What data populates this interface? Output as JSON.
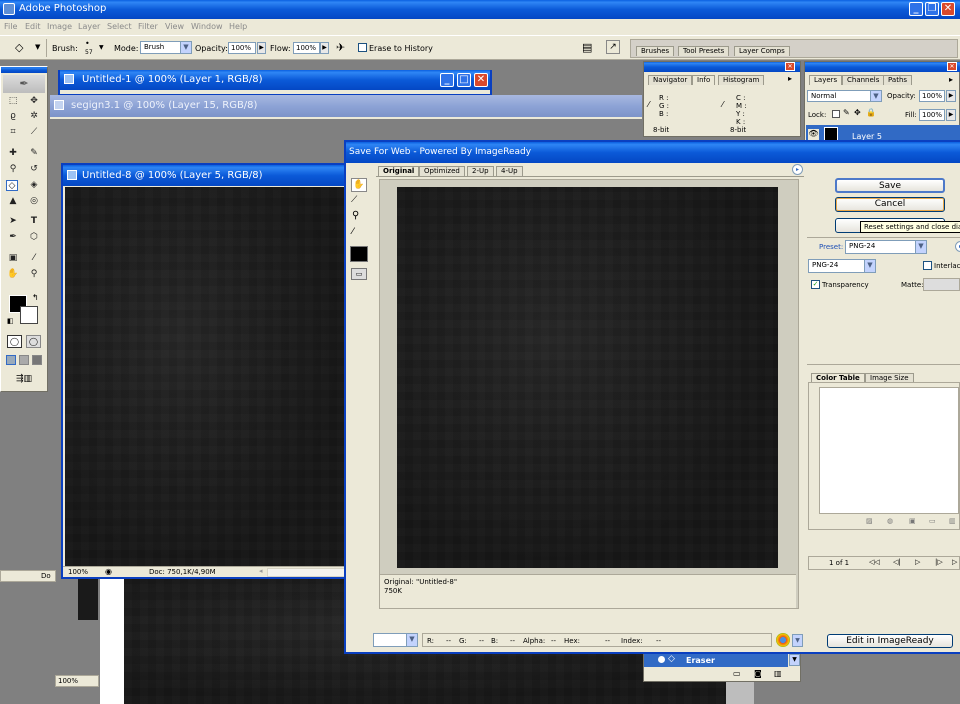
{
  "app": {
    "title": "Adobe Photoshop",
    "menu": [
      "File",
      "Edit",
      "Image",
      "Layer",
      "Select",
      "Filter",
      "View",
      "Window",
      "Help"
    ]
  },
  "options_bar": {
    "brush_label": "Brush:",
    "brush_size": "57",
    "mode_label": "Mode:",
    "mode_value": "Brush",
    "opacity_label": "Opacity:",
    "opacity_value": "100%",
    "flow_label": "Flow:",
    "flow_value": "100%",
    "erase_history_label": "Erase to History",
    "well_tabs": [
      "Brushes",
      "Tool Presets",
      "Layer Comps"
    ]
  },
  "documents": {
    "untitled1": {
      "title": "Untitled-1 @ 100% (Layer 1, RGB/8)"
    },
    "segign": {
      "title": "segign3.1 @ 100% (Layer 15, RGB/8)"
    },
    "untitled8": {
      "title": "Untitled-8 @ 100% (Layer 5, RGB/8)",
      "zoom": "100%",
      "doc_info": "Doc: 750,1K/4,90M"
    },
    "bg_zoom": "100%",
    "bg_doc_prefix": "Do"
  },
  "info_panel": {
    "tabs": [
      "Navigator",
      "Info",
      "Histogram"
    ],
    "left_labels": [
      "R :",
      "G :",
      "B :"
    ],
    "right_labels": [
      "C :",
      "M :",
      "Y :",
      "K :"
    ],
    "left_depth": "8-bit",
    "right_depth": "8-bit"
  },
  "layers_panel": {
    "tabs": [
      "Layers",
      "Channels",
      "Paths"
    ],
    "blend_mode": "Normal",
    "opacity_label": "Opacity:",
    "opacity_value": "100%",
    "lock_label": "Lock:",
    "fill_label": "Fill:",
    "fill_value": "100%",
    "layer_name": "Layer 5"
  },
  "history_panel": {
    "item": "Eraser"
  },
  "save_for_web": {
    "title": "Save For Web - Powered By ImageReady",
    "tabs": [
      "Original",
      "Optimized",
      "2-Up",
      "4-Up"
    ],
    "save_label": "Save",
    "cancel_label": "Cancel",
    "tooltip": "Reset settings and close dialog",
    "preset_label": "Preset:",
    "preset_value": "PNG-24",
    "format_value": "PNG-24",
    "interlaced_label": "Interlaced",
    "transparency_label": "Transparency",
    "matte_label": "Matte:",
    "right_tabs": [
      "Color Table",
      "Image Size"
    ],
    "pagination": "1 of 1",
    "preview_info_line1": "Original: \"Untitled-8\"",
    "preview_info_line2": "750K",
    "status_fields": [
      "R:",
      "--",
      "G:",
      "--",
      "B:",
      "--",
      "Alpha:",
      "--",
      "Hex:",
      "--",
      "Index:",
      "--"
    ],
    "edit_in_imageready": "Edit in ImageReady"
  }
}
